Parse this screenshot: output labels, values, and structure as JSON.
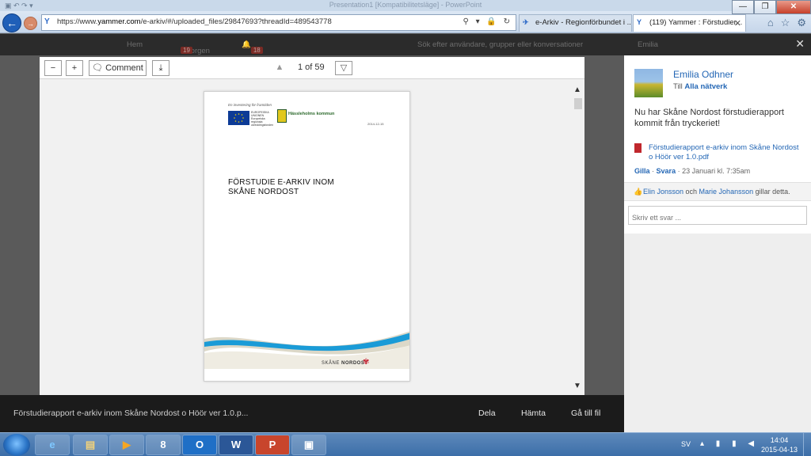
{
  "window": {
    "title": "Presentation1 [Kompatibilitetsläge] - PowerPoint",
    "controls": {
      "minimize": "—",
      "maximize": "❐",
      "close": "✕"
    }
  },
  "browser": {
    "url_prefix": "https://www.",
    "url_domain": "yammer.com",
    "url_path": "/e-arkiv/#/uploaded_files/29847693?threadId=489543778",
    "url_controls": "⚲ ▾ 🔒 ↻",
    "tabs": [
      {
        "label": "e-Arkiv - Regionförbundet i ...",
        "icon": "pin-icon"
      },
      {
        "label": "(119) Yammer : Förstudier...",
        "icon": "yammer-icon",
        "close": "✕"
      }
    ]
  },
  "yammer_header": {
    "home": "Hem",
    "inbox": "Inkorgen",
    "inbox_count": "19",
    "notifications_count": "18",
    "search_placeholder": "Sök efter användare, grupper eller konversationer",
    "user": "Emilia"
  },
  "viewer": {
    "toolbar": {
      "zoom_out": "−",
      "zoom_in": "+",
      "comment": "Comment",
      "download": "⤓",
      "prev": "▲",
      "next": "▽",
      "page_info": "1 of 59"
    },
    "page": {
      "tagline": "En investering för framtiden",
      "eu_text": "EUROPEISKA UNIONEN Europeiska regionala utvecklingsfonden",
      "municipality": "Hässleholms kommun",
      "date": "2014-12-15",
      "title_line1": "FÖRSTUDIE E-ARKIV INOM",
      "title_line2": "SKÅNE NORDOST",
      "logo_text_a": "SKÅNE ",
      "logo_text_b": "NORDOST",
      "logo_flower": "✾"
    }
  },
  "caption": {
    "filename": "Förstudierapport e-arkiv inom Skåne Nordost o Höör ver 1.0.p...",
    "share": "Dela",
    "fetch": "Hämta",
    "goto": "Gå till fil"
  },
  "panel": {
    "author": "Emilia Odhner",
    "to_prefix": "Till ",
    "to_network": "Alla nätverk",
    "message": "Nu har Skåne Nordost förstudierapport kommit från tryckeriet!",
    "attachment": "Förstudierapport e-arkiv inom Skåne Nordost o Höör ver 1.0.pdf",
    "like": "Gilla",
    "separator": "·",
    "reply_link": "Svara",
    "time": "· 23 Januari kl. 7:35am",
    "likers_a": "Elin Jonsson",
    "likers_and": " och ",
    "likers_b": "Marie Johansson",
    "likers_suffix": " gillar detta.",
    "reply_placeholder": "Skriv ett svar ..."
  },
  "taskbar": {
    "apps": [
      {
        "name": "taskbar-ie",
        "glyph": "e"
      },
      {
        "name": "taskbar-explorer",
        "glyph": "▤"
      },
      {
        "name": "taskbar-media",
        "glyph": "▶"
      },
      {
        "name": "taskbar-keepass",
        "glyph": "8"
      },
      {
        "name": "taskbar-outlook",
        "glyph": "O"
      },
      {
        "name": "taskbar-word",
        "glyph": "W"
      },
      {
        "name": "taskbar-powerpoint",
        "glyph": "P"
      },
      {
        "name": "taskbar-screen",
        "glyph": "▣"
      }
    ],
    "language": "SV",
    "time": "14:04",
    "date": "2015-04-13"
  },
  "colors": {
    "link": "#2467b5",
    "taskbar": "#3c6ea8",
    "overlay": "#1b1b1b",
    "brand_red": "#c82333",
    "wave_blue": "#1a9bd7"
  }
}
